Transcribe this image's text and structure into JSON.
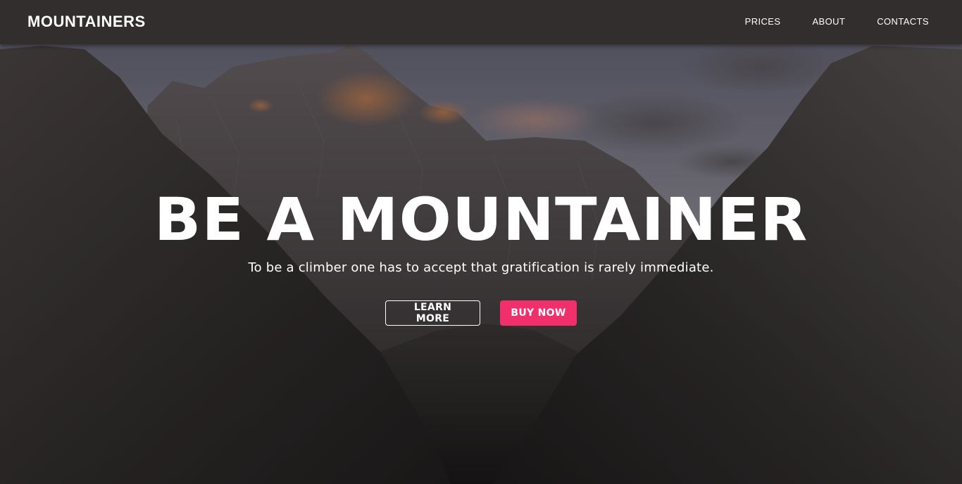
{
  "nav": {
    "brand": "MOUNTAINERS",
    "links": [
      "PRICES",
      "ABOUT",
      "CONTACTS"
    ]
  },
  "hero": {
    "title": "BE A MOUNTAINER",
    "subtitle": "To be a climber one has to accept that gratification is rarely immediate.",
    "learn_more_label": "LEARN MORE",
    "buy_now_label": "BUY NOW"
  },
  "colors": {
    "navbar_bg": "#322e2d",
    "accent": "#f12f6d",
    "text": "#ffffff"
  }
}
